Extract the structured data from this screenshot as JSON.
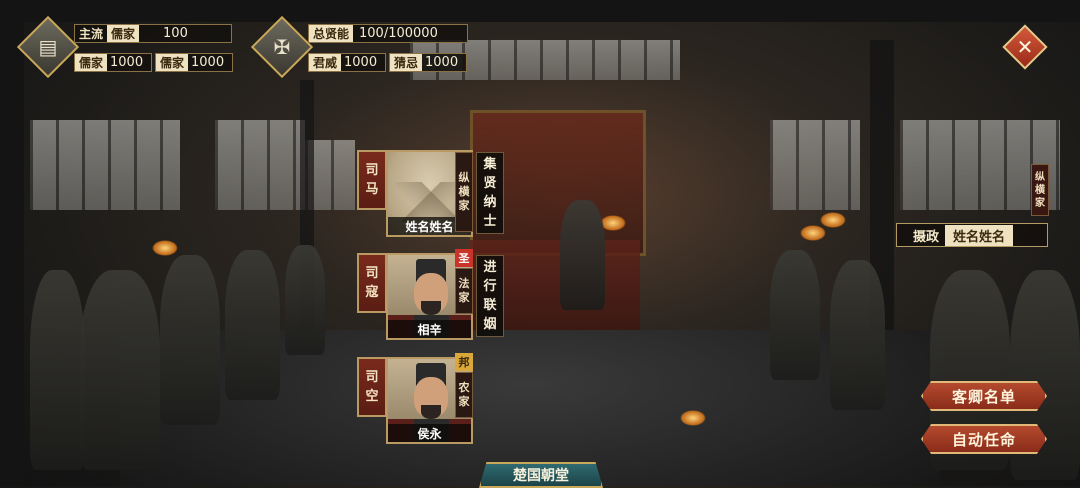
{
  "hud": {
    "left_icon": "scroll-icon",
    "mainstream_label": "主流",
    "mainstream_school": "儒家",
    "mainstream_value": "100",
    "school_a_label": "儒家",
    "school_a_value": "1000",
    "school_b_label": "儒家",
    "school_b_value": "1000",
    "right_icon": "crossbow-icon",
    "total_talent_label": "总贤能",
    "total_talent_value": "100/100000",
    "prestige_label": "君威",
    "prestige_value": "1000",
    "suspicion_label": "猜忌",
    "suspicion_value": "1000"
  },
  "close_icon": "close-icon",
  "ministers": [
    {
      "office": [
        "司",
        "马"
      ],
      "name": "姓名姓名",
      "portrait": "empty",
      "school": [
        "纵",
        "横",
        "家"
      ],
      "badge": "",
      "policy": [
        "集",
        "贤",
        "纳",
        "士"
      ]
    },
    {
      "office": [
        "司",
        "寇"
      ],
      "name": "相辛",
      "portrait": "person",
      "school": [
        "法",
        "家"
      ],
      "badge": "圣",
      "policy": [
        "进",
        "行",
        "联",
        "姻"
      ]
    },
    {
      "office": [
        "司",
        "空"
      ],
      "name": "侯永",
      "portrait": "person",
      "school": [
        "农",
        "家"
      ],
      "badge": "邦",
      "policy": []
    }
  ],
  "regent": {
    "school": [
      "纵",
      "横",
      "家"
    ],
    "label": "摄政",
    "name": "姓名姓名"
  },
  "buttons": {
    "guest_list": "客卿名单",
    "auto_appoint": "自动任命"
  },
  "court_title": "楚国朝堂",
  "colors": {
    "accent_red": "#9a2b18",
    "gold_border": "#c9a85a",
    "teal_tab": "#2f6a70"
  }
}
